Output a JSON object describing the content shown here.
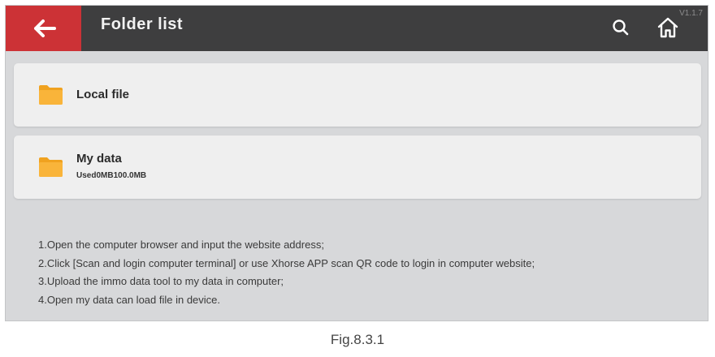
{
  "header": {
    "title": "Folder list",
    "version": "V1.1.7",
    "colors": {
      "bar": "#3e3e3f",
      "back": "#cc3236"
    }
  },
  "folders": [
    {
      "label": "Local file",
      "icon": "folder-icon"
    },
    {
      "label": "My data",
      "subtitle": "Used0MB100.0MB",
      "icon": "folder-icon"
    }
  ],
  "instructions": [
    "1.Open the computer browser and input the website address;",
    "2.Click [Scan and login computer terminal] or use Xhorse APP scan QR code to login in computer website;",
    "3.Upload the immo data tool to my data in computer;",
    "4.Open my data can load file in device."
  ],
  "caption": "Fig.8.3.1"
}
